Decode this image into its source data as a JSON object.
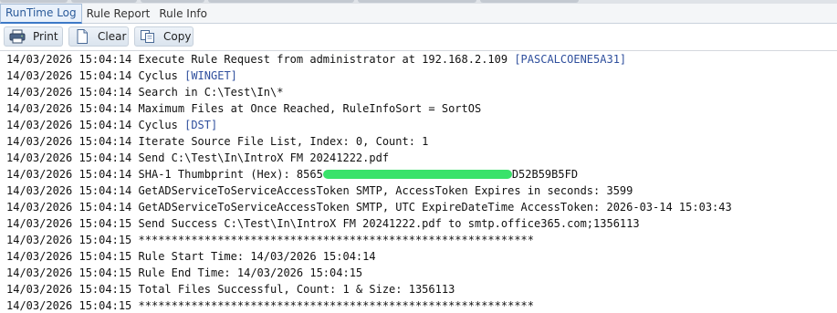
{
  "tabs": [
    {
      "label": "RunTime Log",
      "active": true
    },
    {
      "label": "Rule Report",
      "active": false
    },
    {
      "label": "Rule Info",
      "active": false
    }
  ],
  "toolbar": {
    "print_label": "Print",
    "clear_label": "Clear",
    "copy_label": "Copy"
  },
  "colors": {
    "accent_text": "#2f4f9d",
    "redaction": "#39e26a",
    "active_tab_border": "#3c79c7"
  },
  "log": [
    {
      "ts": "14/03/2026 15:04:14",
      "text": "Execute Rule Request from administrator at 192.168.2.109 ",
      "tag": "[PASCALCOENE5A31]"
    },
    {
      "ts": "14/03/2026 15:04:14",
      "text": "Cyclus ",
      "tag": "[WINGET]"
    },
    {
      "ts": "14/03/2026 15:04:14",
      "text": "Search in C:\\Test\\In\\*",
      "tag": ""
    },
    {
      "ts": "14/03/2026 15:04:14",
      "text": "Maximum Files at Once Reached, RuleInfoSort = SortOS",
      "tag": ""
    },
    {
      "ts": "14/03/2026 15:04:14",
      "text": "Cyclus ",
      "tag": "[DST]"
    },
    {
      "ts": "14/03/2026 15:04:14",
      "text": "Iterate Source File List, Index: 0, Count: 1",
      "tag": ""
    },
    {
      "ts": "14/03/2026 15:04:14",
      "text": "Send C:\\Test\\In\\IntroX FM 20241222.pdf",
      "tag": ""
    },
    {
      "ts": "14/03/2026 15:04:14",
      "text": "SHA-1 Thumbprint (Hex): 8565",
      "tag": "",
      "redacted": true,
      "text_after": "D52B59B5FD"
    },
    {
      "ts": "14/03/2026 15:04:14",
      "text": "GetADServiceToServiceAccessToken SMTP, AccessToken Expires in seconds: 3599",
      "tag": ""
    },
    {
      "ts": "14/03/2026 15:04:14",
      "text": "GetADServiceToServiceAccessToken SMTP, UTC ExpireDateTime AccessToken: 2026-03-14 15:03:43",
      "tag": ""
    },
    {
      "ts": "14/03/2026 15:04:15",
      "text": "Send Success C:\\Test\\In\\IntroX FM 20241222.pdf to smtp.office365.com;1356113",
      "tag": ""
    },
    {
      "ts": "14/03/2026 15:04:15",
      "text": "************************************************************",
      "tag": ""
    },
    {
      "ts": "14/03/2026 15:04:15",
      "text": "Rule Start Time: 14/03/2026 15:04:14",
      "tag": ""
    },
    {
      "ts": "14/03/2026 15:04:15",
      "text": "Rule End Time: 14/03/2026 15:04:15",
      "tag": ""
    },
    {
      "ts": "14/03/2026 15:04:15",
      "text": "Total Files Successful, Count: 1 & Size: 1356113",
      "tag": ""
    },
    {
      "ts": "14/03/2026 15:04:15",
      "text": "************************************************************",
      "tag": ""
    }
  ]
}
